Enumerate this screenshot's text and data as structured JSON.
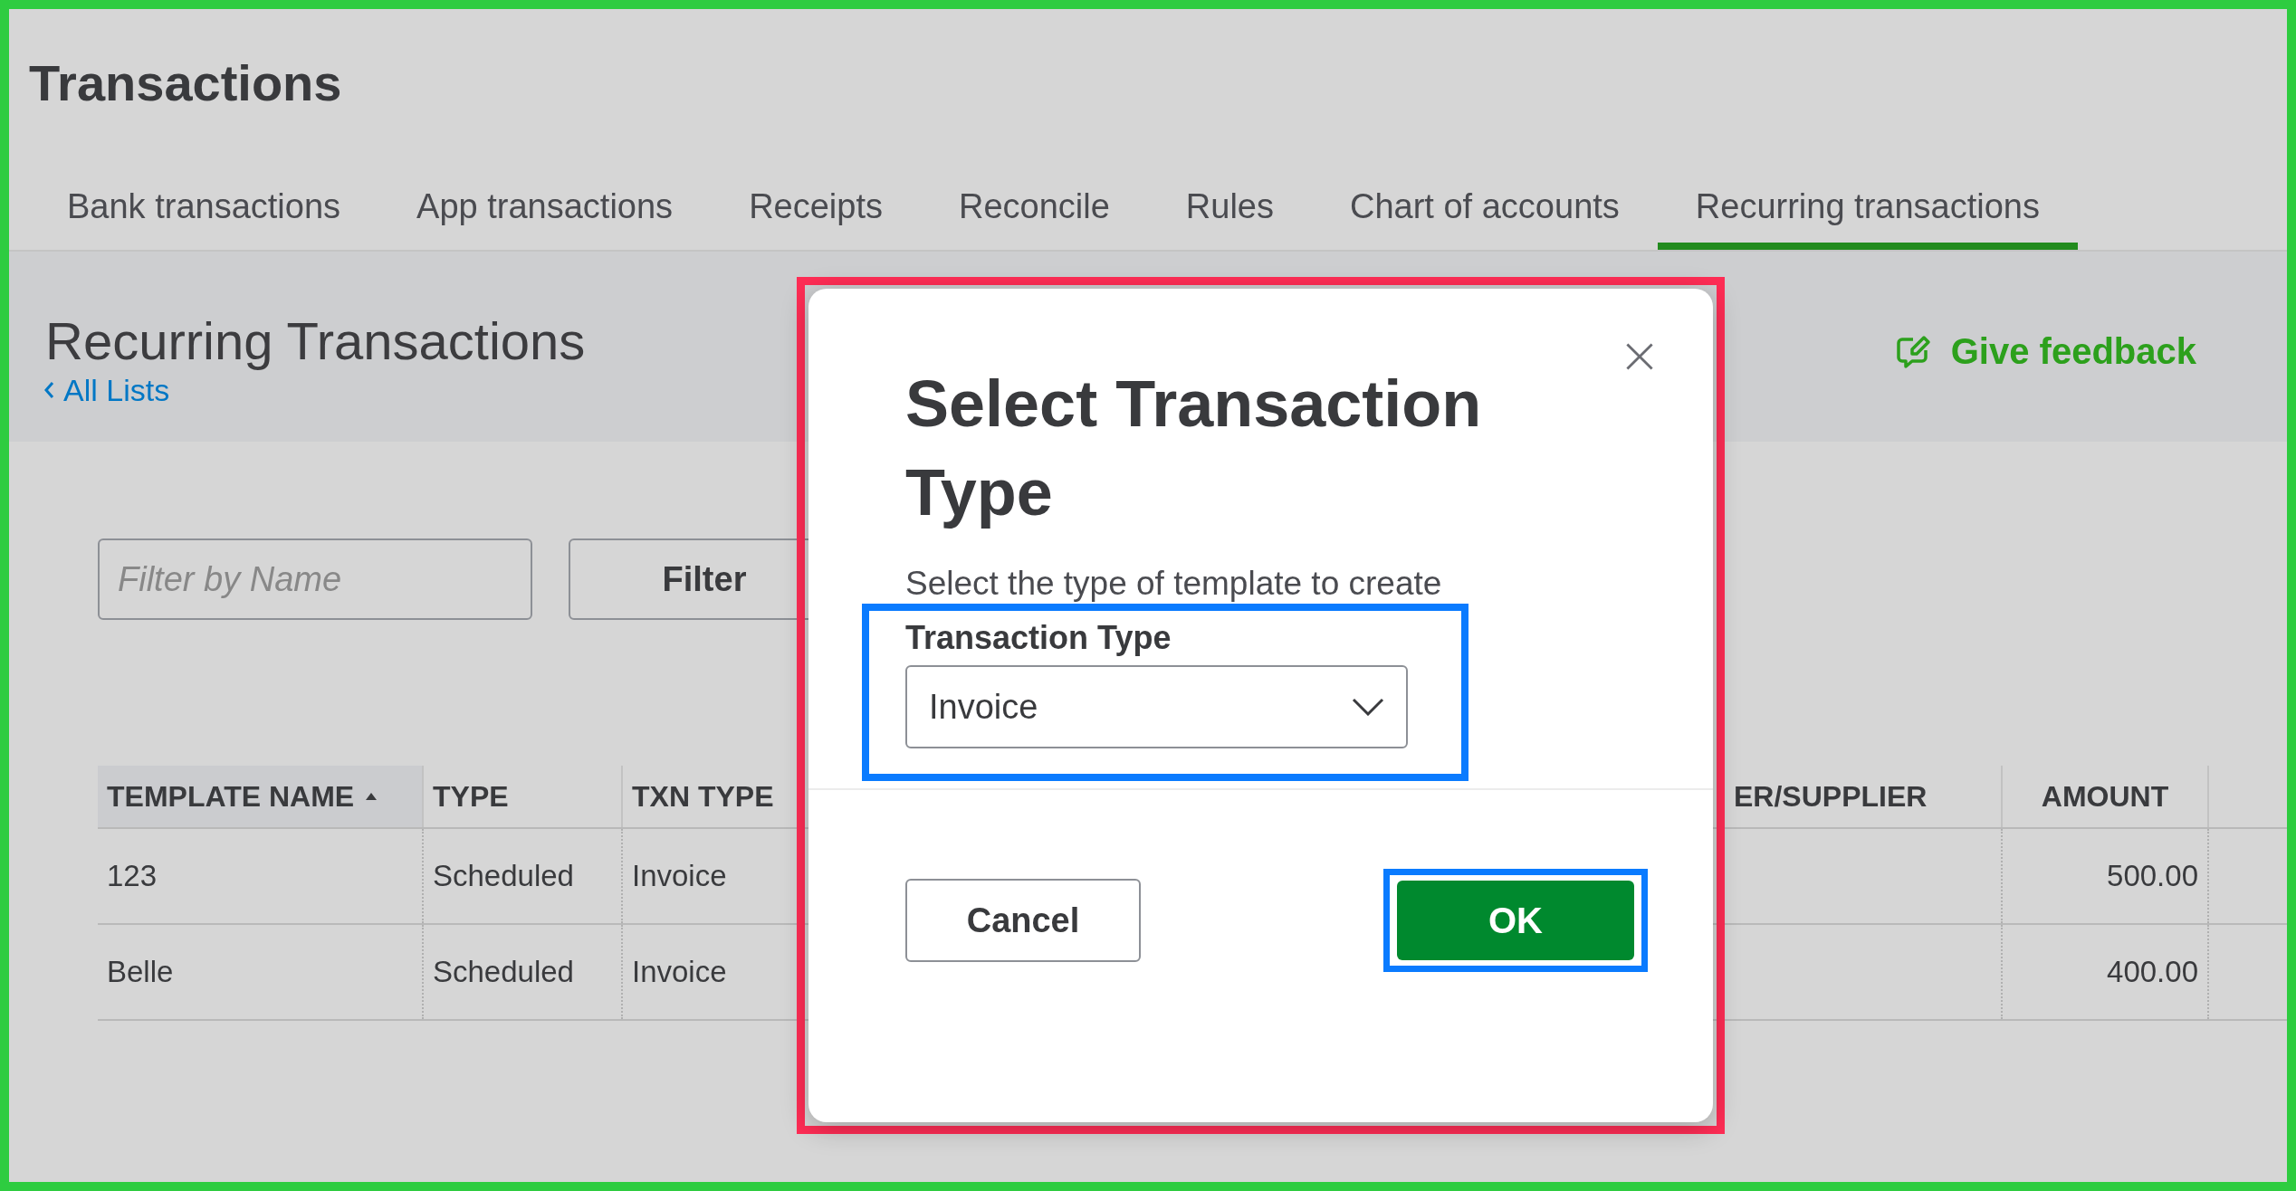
{
  "page": {
    "title": "Transactions"
  },
  "tabs": [
    {
      "label": "Bank transactions",
      "selected": false
    },
    {
      "label": "App transactions",
      "selected": false
    },
    {
      "label": "Receipts",
      "selected": false
    },
    {
      "label": "Reconcile",
      "selected": false
    },
    {
      "label": "Rules",
      "selected": false
    },
    {
      "label": "Chart of accounts",
      "selected": false
    },
    {
      "label": "Recurring transactions",
      "selected": true
    }
  ],
  "header": {
    "title": "Recurring Transactions",
    "back_link": "All Lists",
    "feedback": "Give feedback"
  },
  "filter": {
    "placeholder": "Filter by Name",
    "button": "Filter"
  },
  "table": {
    "columns": [
      {
        "label": "TEMPLATE NAME",
        "sorted": true
      },
      {
        "label": "TYPE",
        "sorted": false
      },
      {
        "label": "TXN TYPE",
        "sorted": false
      },
      {
        "label": "ER/SUPPLIER",
        "sorted": false
      },
      {
        "label": "AMOUNT",
        "sorted": false
      }
    ],
    "rows": [
      {
        "template_name": "123",
        "type": "Scheduled",
        "txn_type": "Invoice",
        "amount": "500.00"
      },
      {
        "template_name": "Belle",
        "type": "Scheduled",
        "txn_type": "Invoice",
        "amount": "400.00"
      }
    ]
  },
  "dialog": {
    "title": "Select Transaction Type",
    "subtitle": "Select the type of template to create",
    "field_label": "Transaction Type",
    "field_value": "Invoice",
    "cancel": "Cancel",
    "ok": "OK"
  }
}
